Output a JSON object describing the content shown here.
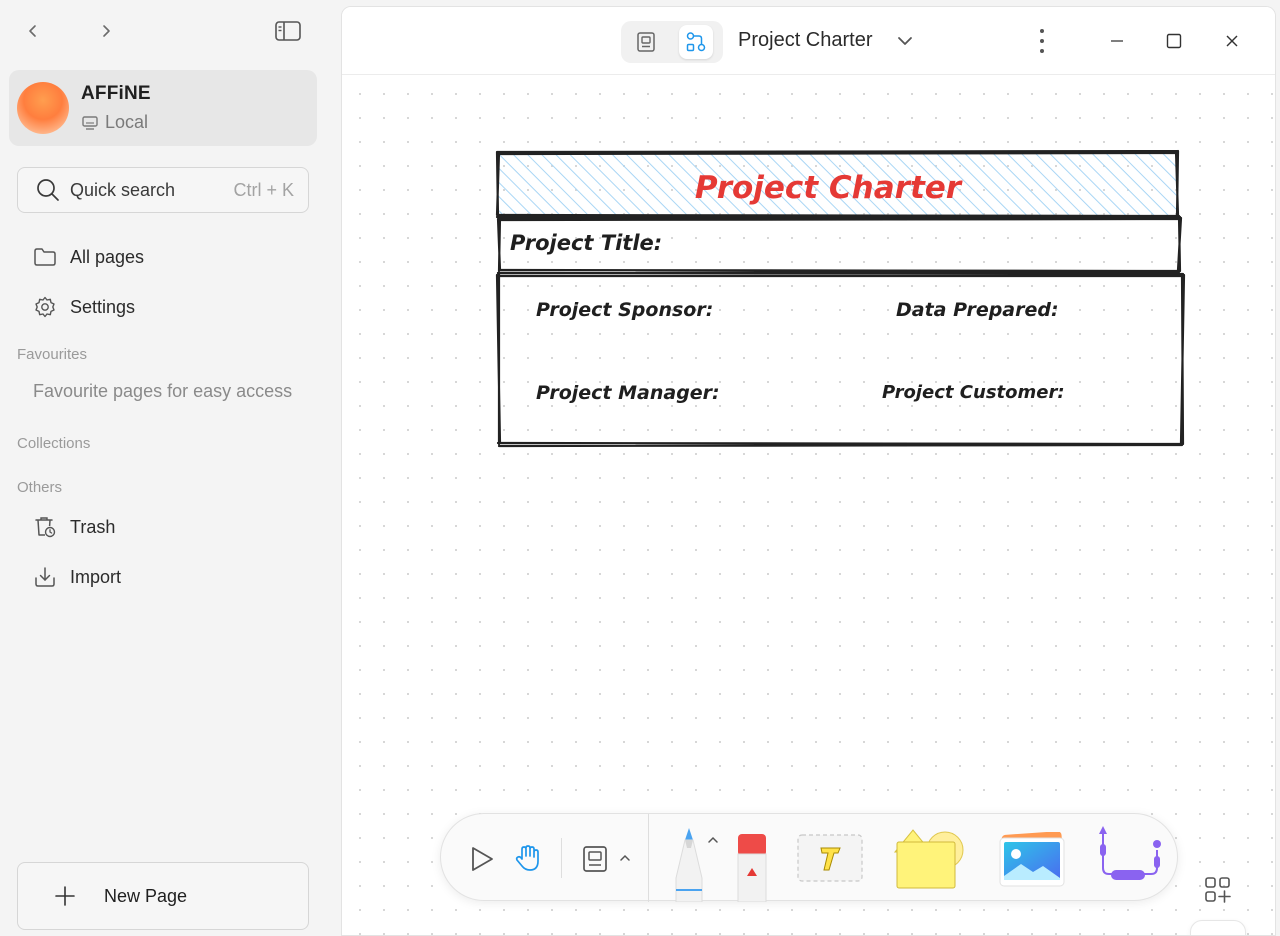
{
  "sidebar": {
    "workspace": {
      "name": "AFFiNE",
      "storage": "Local"
    },
    "search": {
      "label": "Quick search",
      "shortcut": "Ctrl + K"
    },
    "items": [
      {
        "label": "All pages",
        "icon": "folder-icon"
      },
      {
        "label": "Settings",
        "icon": "gear-icon"
      }
    ],
    "sections": {
      "favourites": "Favourites",
      "favourites_empty": "Favourite pages for easy access",
      "collections": "Collections",
      "others": "Others"
    },
    "others_items": [
      {
        "label": "Trash",
        "icon": "trash-icon"
      },
      {
        "label": "Import",
        "icon": "import-icon"
      }
    ],
    "new_page_label": "New Page"
  },
  "header": {
    "title": "Project Charter",
    "mode": "edgeless"
  },
  "canvas": {
    "charter": {
      "heading": "Project Charter",
      "title_label": "Project Title:",
      "sponsor_label": "Project Sponsor:",
      "data_prepared_label": "Data Prepared:",
      "manager_label": "Project Manager:",
      "customer_label": "Project Customer:"
    }
  },
  "toolbar": {
    "tools": [
      "select-tool",
      "hand-tool",
      "frame-tool",
      "pen-tool",
      "eraser-tool",
      "text-tool",
      "shape-tool",
      "image-tool",
      "connector-tool"
    ]
  },
  "colors": {
    "accent": "#1e96eb",
    "heading_red": "#e53935",
    "hatch_blue": "#a9d6f5",
    "pen_blue": "#4aa3f0",
    "note_yellow": "#fff37a"
  }
}
